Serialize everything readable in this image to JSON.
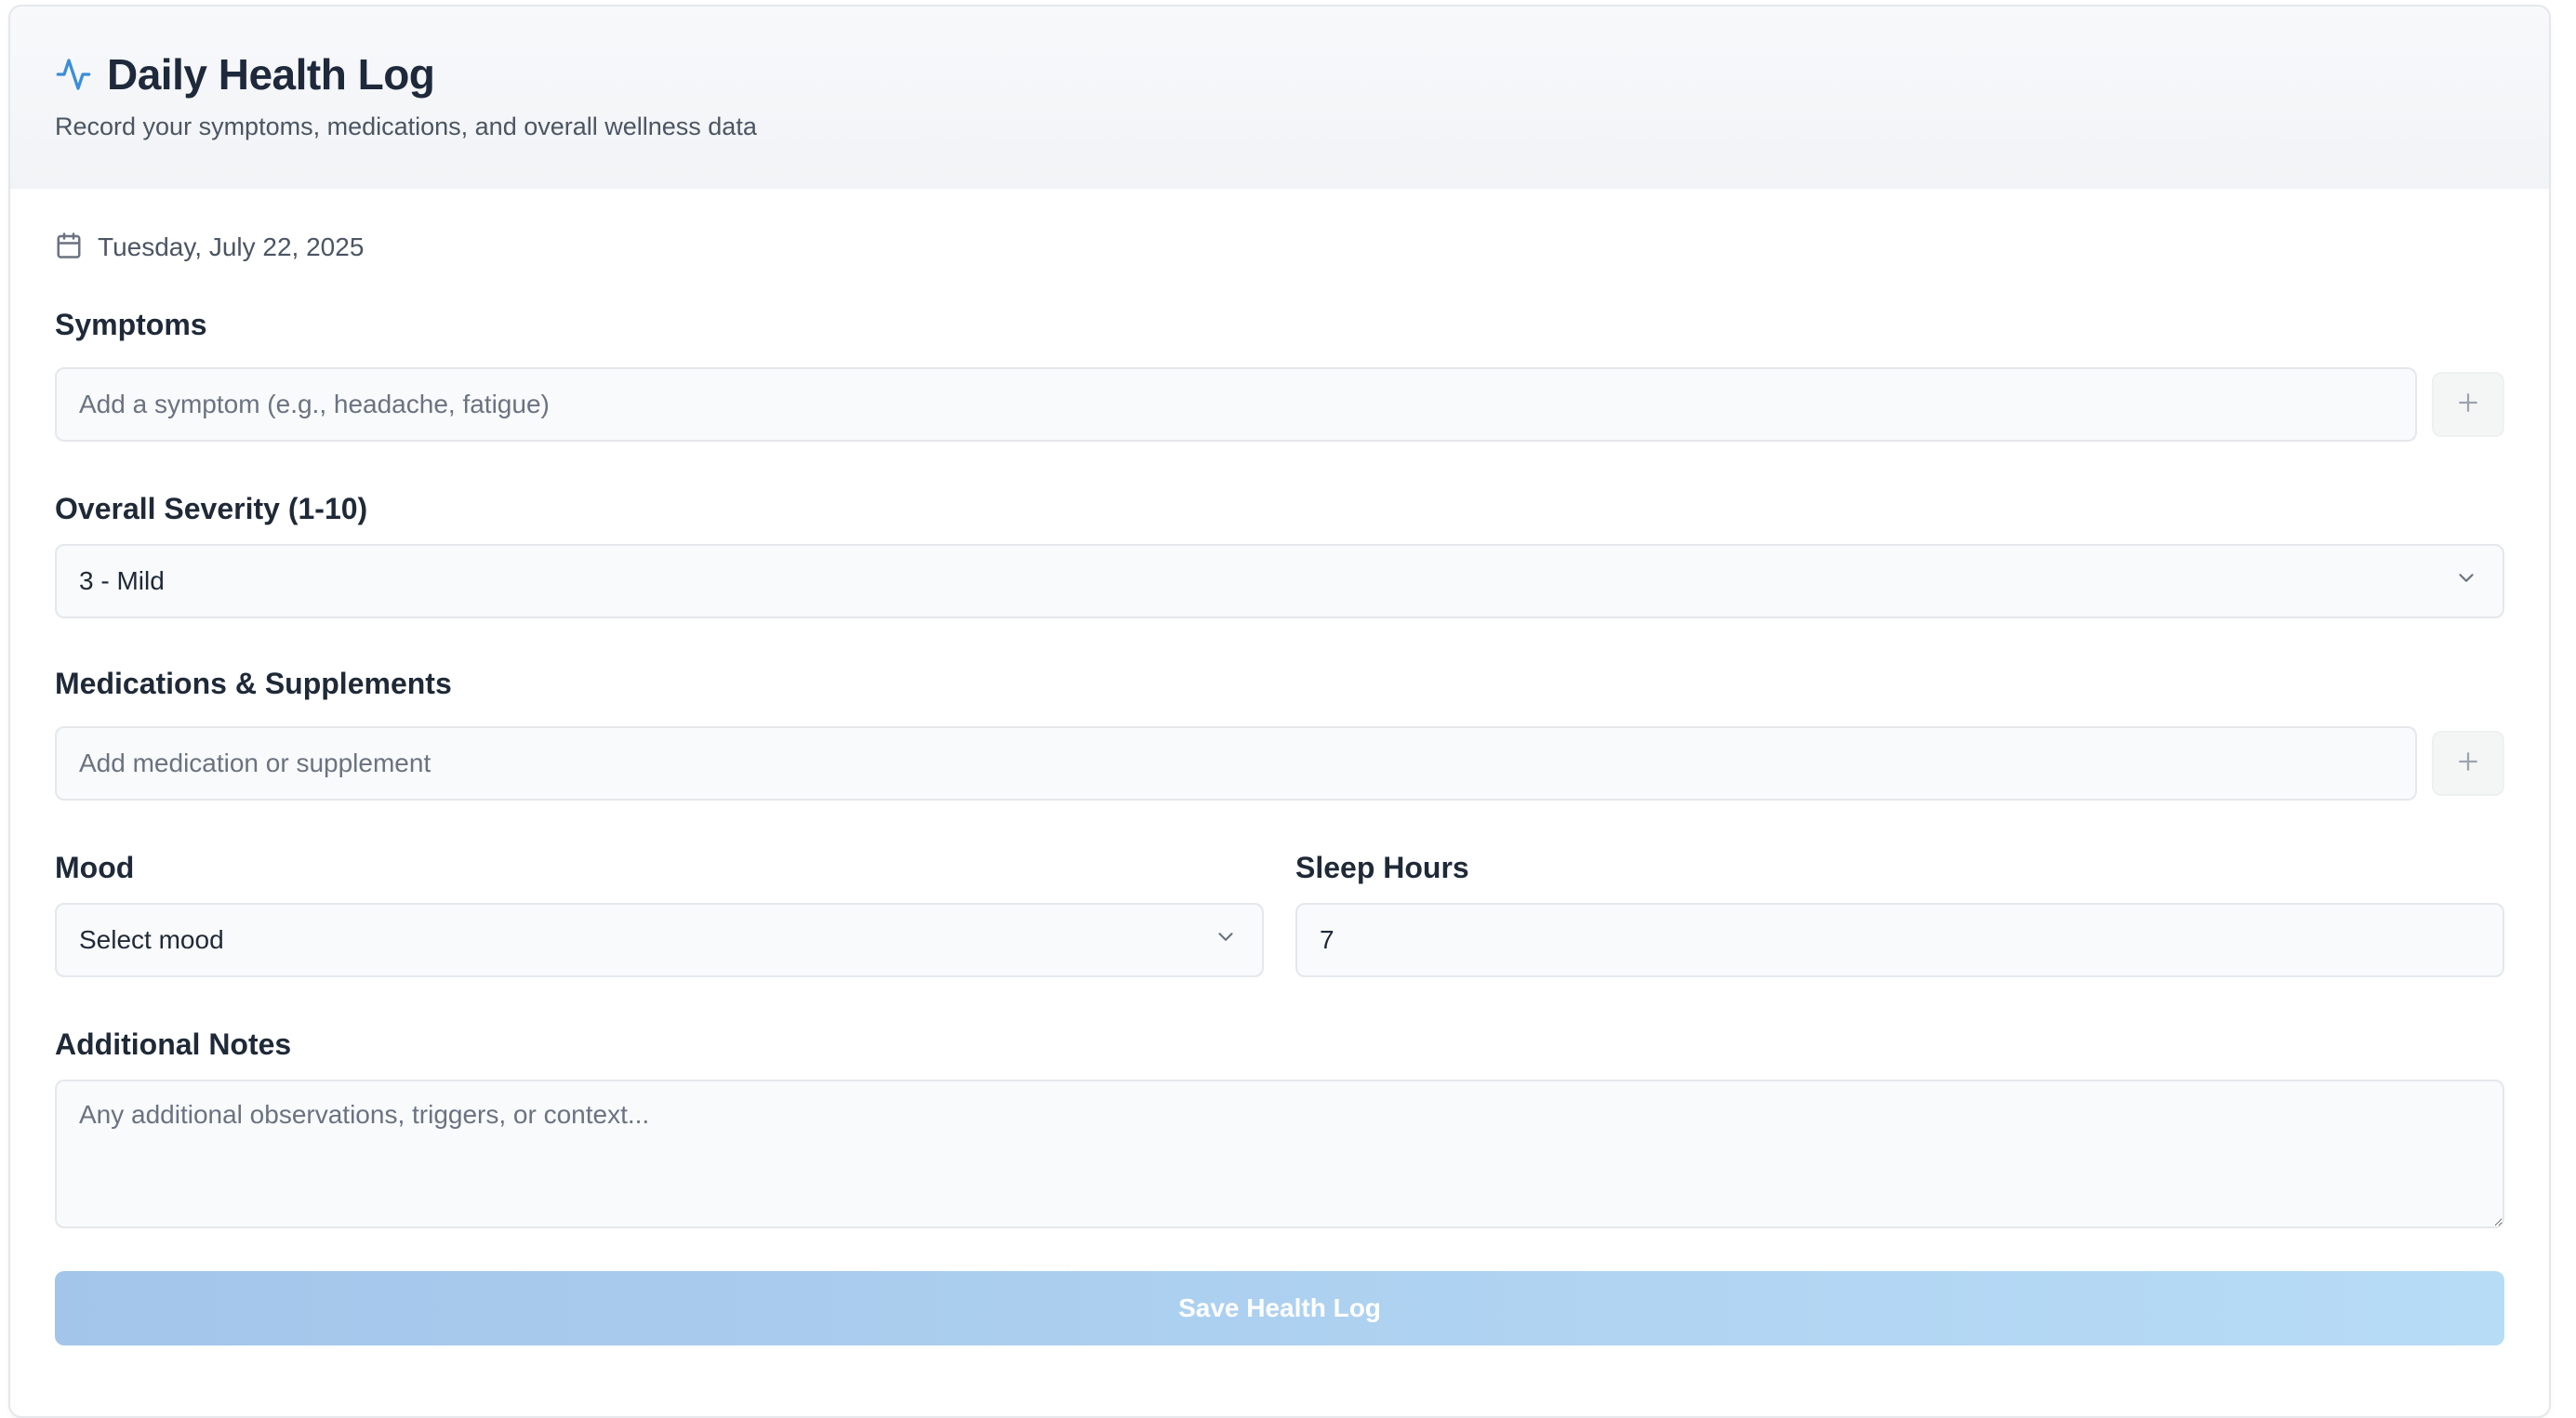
{
  "header": {
    "icon": "activity-icon",
    "title": "Daily Health Log",
    "subtitle": "Record your symptoms, medications, and overall wellness data",
    "accent_color": "#3b8ed6"
  },
  "date": {
    "icon": "calendar-icon",
    "text": "Tuesday, July 22, 2025"
  },
  "symptoms": {
    "label": "Symptoms",
    "placeholder": "Add a symptom (e.g., headache, fatigue)",
    "add_icon": "plus-icon"
  },
  "severity": {
    "label": "Overall Severity (1-10)",
    "selected": "3 - Mild"
  },
  "medications": {
    "label": "Medications & Supplements",
    "placeholder": "Add medication or supplement",
    "add_icon": "plus-icon"
  },
  "mood": {
    "label": "Mood",
    "selected": "Select mood"
  },
  "sleep": {
    "label": "Sleep Hours",
    "value": "7"
  },
  "notes": {
    "label": "Additional Notes",
    "placeholder": "Any additional observations, triggers, or context..."
  },
  "save_button": {
    "label": "Save Health Log",
    "gradient_start": "#a3c5ea",
    "gradient_end": "#b7dcf6"
  }
}
